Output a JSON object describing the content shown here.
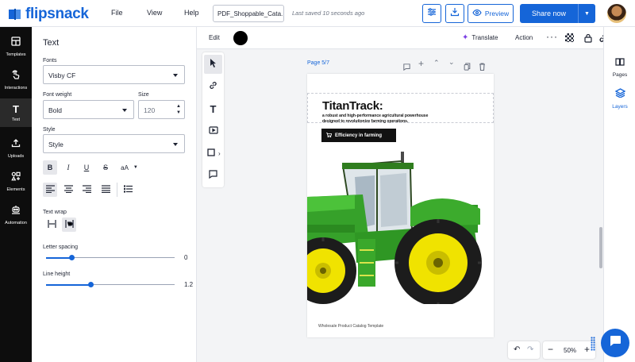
{
  "app": {
    "logo_text": "flipsnack",
    "brand_color": "#1565d8"
  },
  "menu": {
    "file": "File",
    "view": "View",
    "help": "Help"
  },
  "document": {
    "name": "PDF_Shoppable_Cata...",
    "saved_status": "Last saved 10 seconds ago"
  },
  "toolbar": {
    "preview_label": "Preview",
    "share_label": "Share now"
  },
  "leftnav": [
    {
      "label": "Templates",
      "icon": "templates-icon"
    },
    {
      "label": "Interactions",
      "icon": "interactions-icon"
    },
    {
      "label": "Text",
      "icon": "text-icon",
      "active": true
    },
    {
      "label": "Uploads",
      "icon": "uploads-icon"
    },
    {
      "label": "Elements",
      "icon": "elements-icon"
    },
    {
      "label": "Automation",
      "icon": "automation-icon"
    }
  ],
  "panel": {
    "title": "Text",
    "fonts_label": "Fonts",
    "font_value": "Visby CF",
    "weight_label": "Font weight",
    "weight_value": "Bold",
    "size_label": "Size",
    "size_value": "120",
    "style_label": "Style",
    "style_value": "Style",
    "case_label": "aA",
    "wrap_label": "Text wrap",
    "letter_spacing_label": "Letter spacing",
    "letter_spacing_value": "0",
    "letter_spacing_level": 0.2,
    "line_height_label": "Line height",
    "line_height_value": "1.2",
    "line_height_level": 0.35
  },
  "edit_bar": {
    "edit_label": "Edit",
    "color": "#000000",
    "translate_label": "Translate",
    "action_label": "Action"
  },
  "page": {
    "indicator": "Page 5/7",
    "title": "TitanTrack:",
    "subtitle_line1": "a robust and high-performance agricultural powerhouse",
    "subtitle_line2": "designed to revolutionize farming operations.",
    "button_label": "Efficiency in farming",
    "footer": "Wholesale Product Catalog Template"
  },
  "rightnav": [
    {
      "label": "Pages",
      "icon": "pages-icon"
    },
    {
      "label": "Layers",
      "icon": "layers-icon",
      "active": true
    }
  ],
  "zoom": {
    "value": "50%"
  }
}
